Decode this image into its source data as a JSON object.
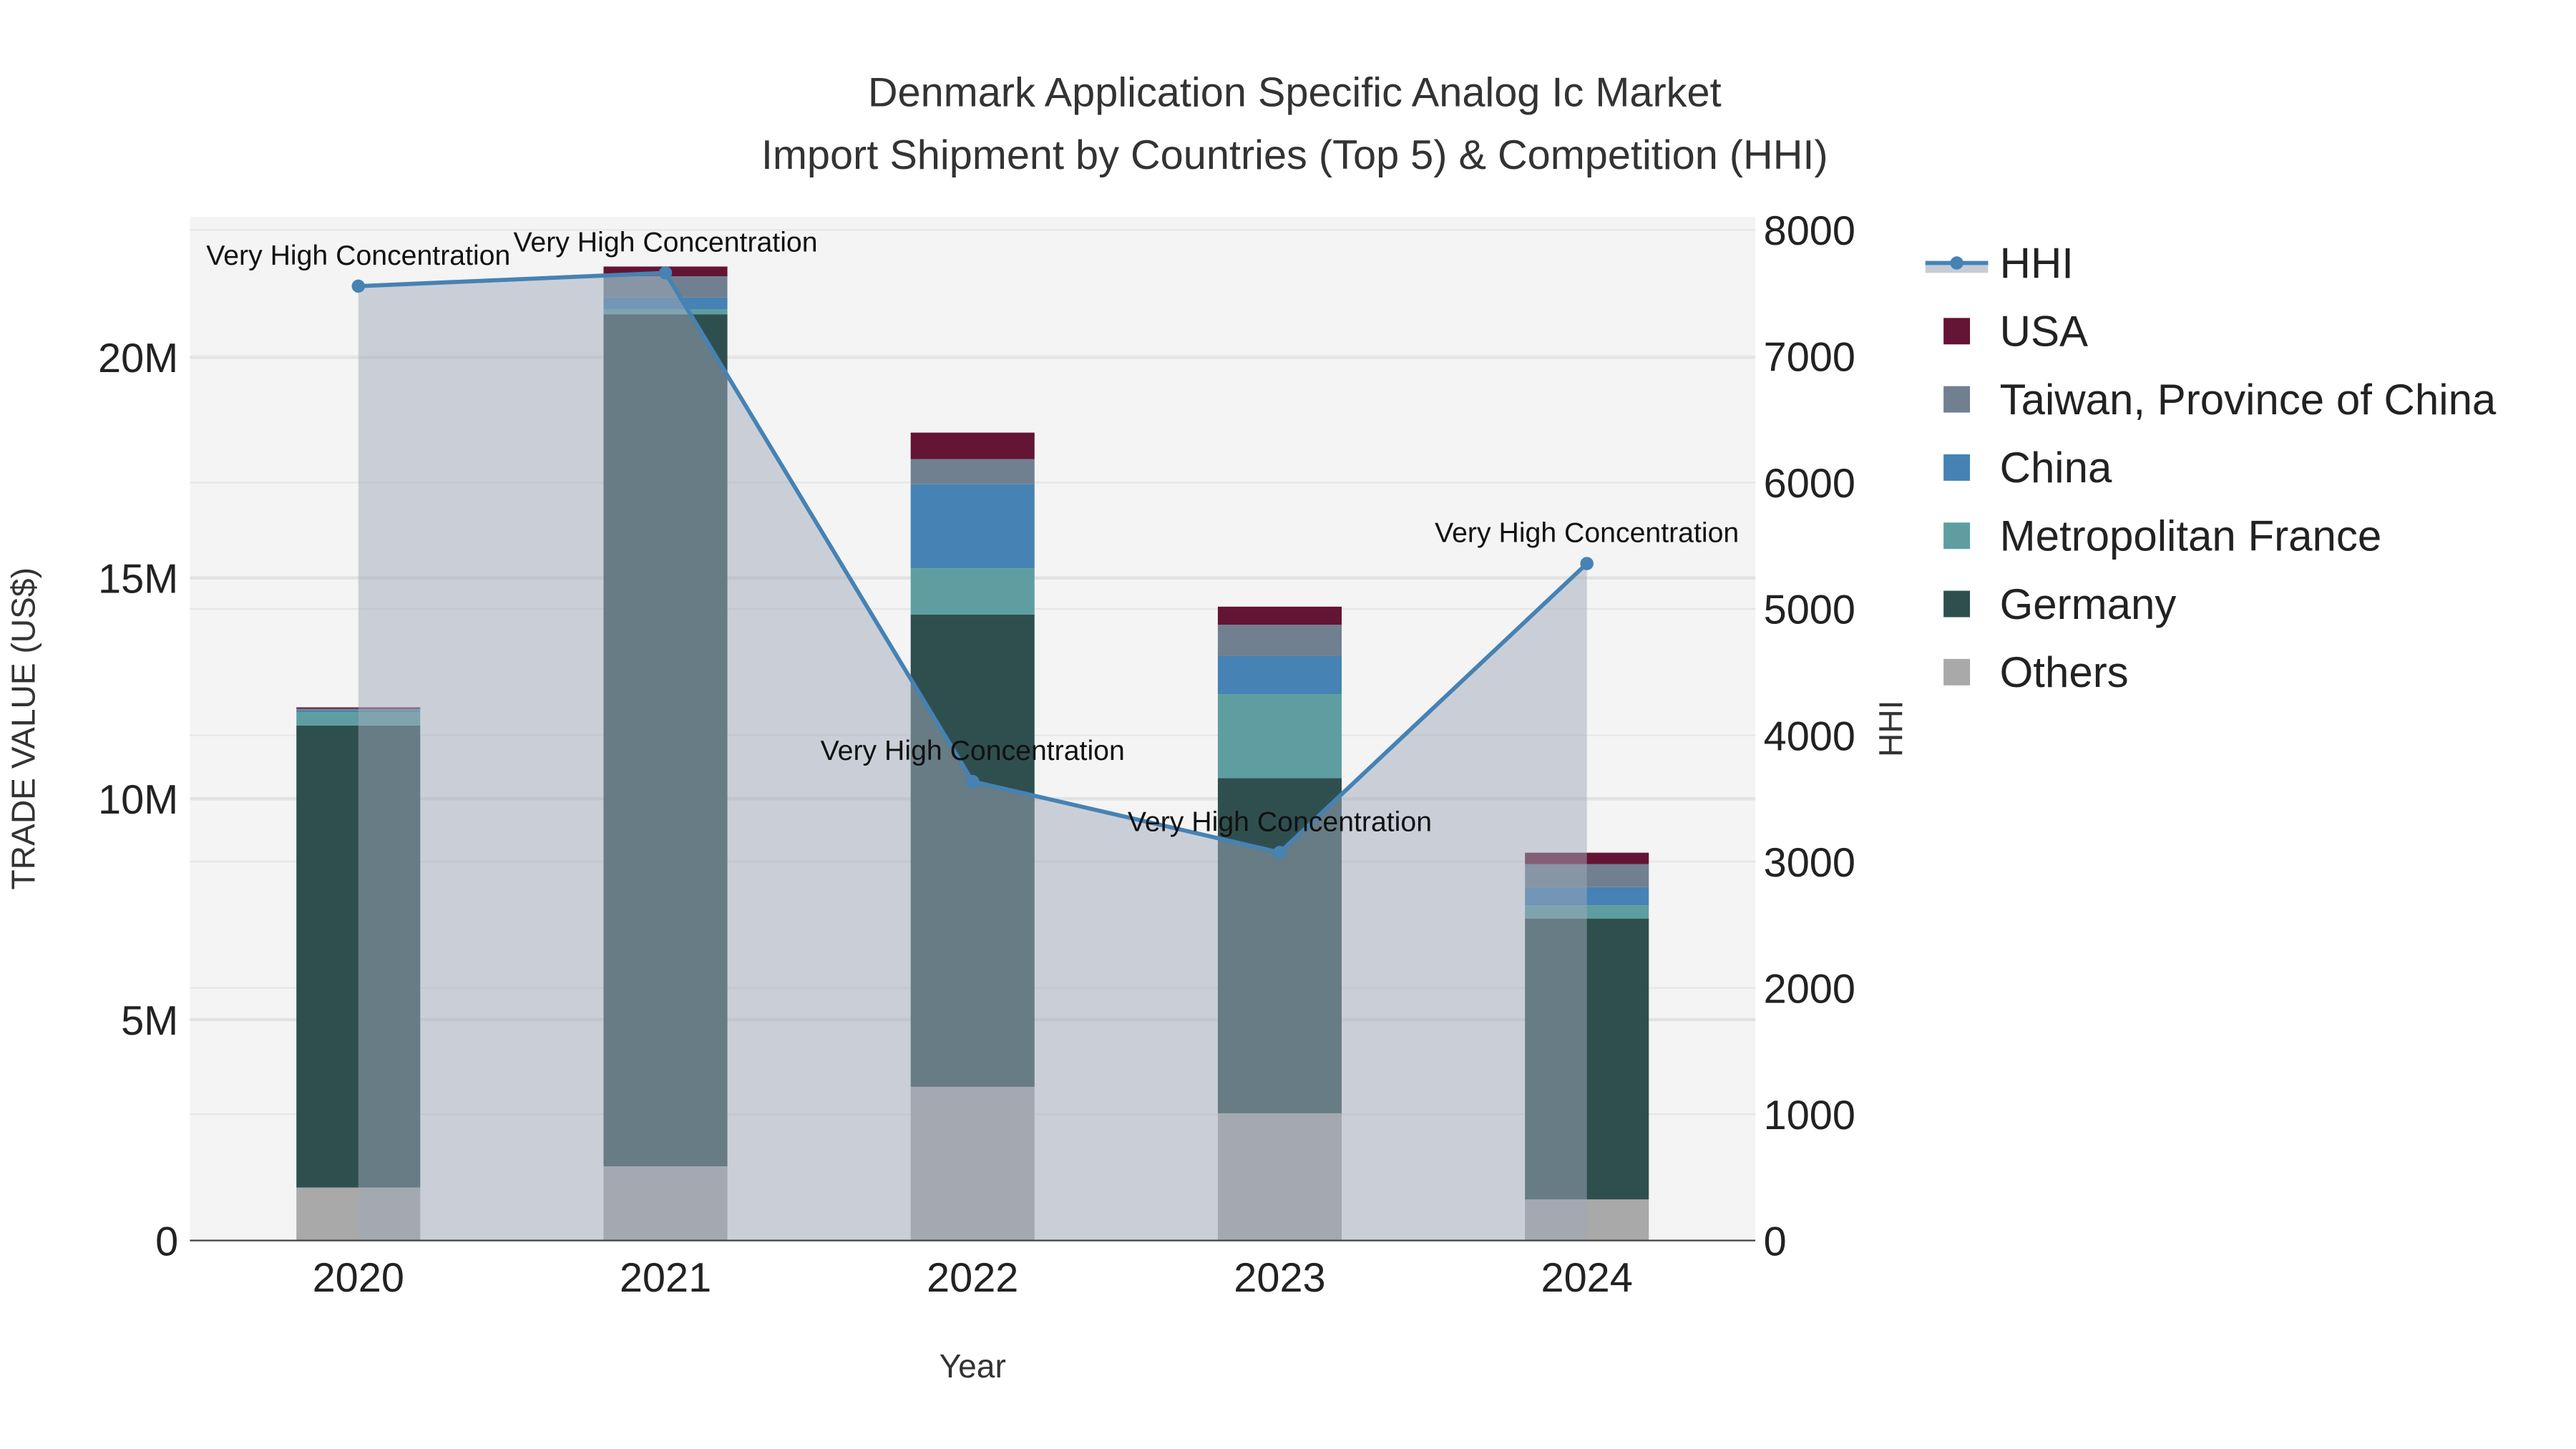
{
  "chart_data": {
    "type": "bar",
    "title": [
      "Denmark Application Specific Analog Ic Market",
      "Import Shipment by Countries (Top 5) & Competition (HHI)"
    ],
    "xlabel": "Year",
    "ylabel": "TRADE VALUE (US$)",
    "y2label": "HHI",
    "categories": [
      "2020",
      "2021",
      "2022",
      "2023",
      "2024"
    ],
    "ylim": [
      0,
      23000000
    ],
    "y_ticks": [
      {
        "v": 0,
        "label": "0"
      },
      {
        "v": 5000000,
        "label": "5M"
      },
      {
        "v": 10000000,
        "label": "10M"
      },
      {
        "v": 15000000,
        "label": "15M"
      },
      {
        "v": 20000000,
        "label": "20M"
      }
    ],
    "y2lim": [
      0,
      8000
    ],
    "y2_ticks": [
      "0",
      "1000",
      "2000",
      "3000",
      "4000",
      "5000",
      "6000",
      "7000",
      "8000"
    ],
    "series": [
      {
        "name": "Others",
        "color": "#a9a9a9",
        "values": [
          1200000,
          1680000,
          3480000,
          2880000,
          930000
        ]
      },
      {
        "name": "Germany",
        "color": "#2f4f4f",
        "values": [
          10460000,
          19290000,
          10690000,
          7590000,
          6360000
        ]
      },
      {
        "name": "Metropolitan France",
        "color": "#5f9ea0",
        "values": [
          300000,
          110000,
          1050000,
          1900000,
          300000
        ]
      },
      {
        "name": "China",
        "color": "#4682b4",
        "values": [
          40000,
          270000,
          1910000,
          860000,
          410000
        ]
      },
      {
        "name": "Taiwan, Province of China",
        "color": "#708090",
        "values": [
          40000,
          480000,
          560000,
          710000,
          520000
        ]
      },
      {
        "name": "USA",
        "color": "#641434",
        "values": [
          30000,
          220000,
          600000,
          410000,
          260000
        ]
      }
    ],
    "hhi": {
      "name": "HHI",
      "color": "#4682b4",
      "values": [
        7555,
        7660,
        3634,
        3072,
        5359
      ],
      "labels": [
        "Very High Concentration",
        "Very High Concentration",
        "Very High Concentration",
        "Very High Concentration",
        "Very High Concentration"
      ]
    },
    "legend": [
      "HHI",
      "USA",
      "Taiwan, Province of China",
      "China",
      "Metropolitan France",
      "Germany",
      "Others"
    ],
    "legend_position": "right"
  }
}
